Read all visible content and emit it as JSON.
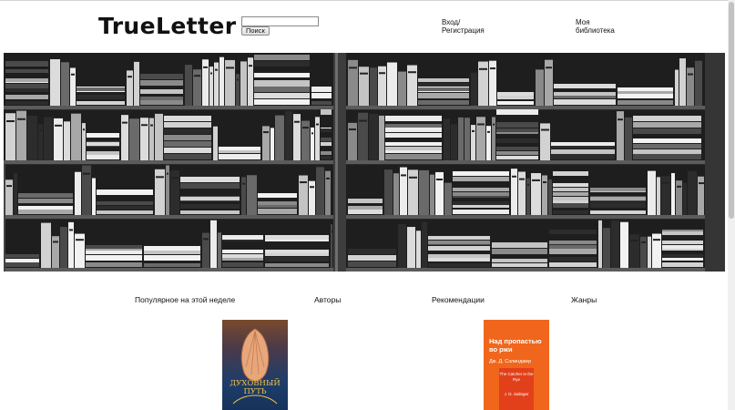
{
  "header": {
    "logo": "TrueLetter",
    "search_placeholder": "",
    "search_button": "Поиск",
    "login_link": "Вход/ Регистрация",
    "library_link": "Моя библиотека"
  },
  "nav": {
    "popular": "Популярное на этой неделе",
    "authors": "Авторы",
    "recommendations": "Рекомендации",
    "genres": "Жанры"
  },
  "books": [
    {
      "title": "ДУХОВНЫЙ ПУТЬ",
      "cover_color": "#1d3d6b"
    },
    {
      "title": "Над пропастью во ржи",
      "author": "Дж. Д. Сэлинджер",
      "inner_text": "The Catcher in the Rye",
      "inner_author": "J. D. Salinger",
      "cover_color": "#f0661c"
    }
  ]
}
